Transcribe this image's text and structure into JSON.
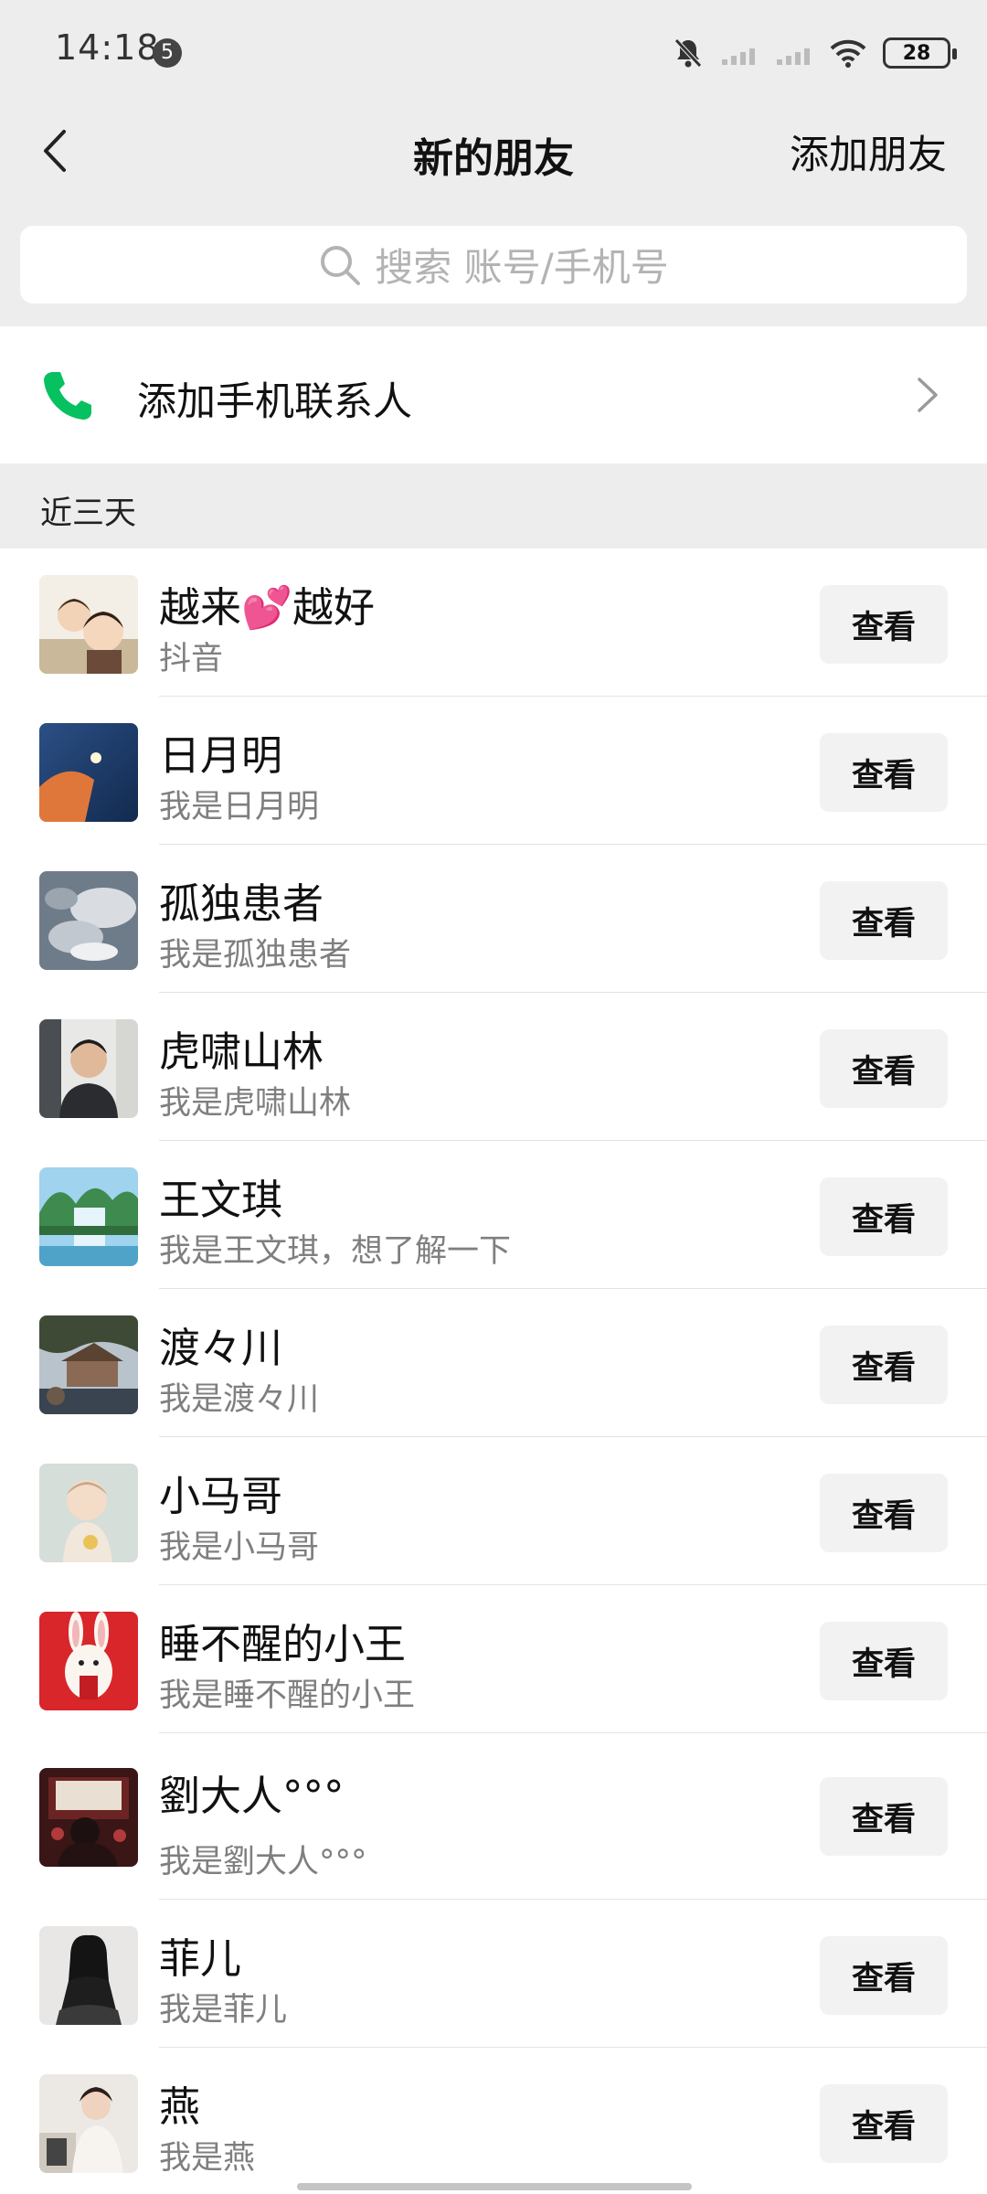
{
  "status_bar": {
    "time": "14:18",
    "notification_badge": "5",
    "battery_level": "28",
    "icons": [
      "mute-bell-icon",
      "signal-icon",
      "signal-icon",
      "wifi-icon",
      "battery-icon"
    ]
  },
  "nav": {
    "title": "新的朋友",
    "action_label": "添加朋友",
    "back_icon": "chevron-left-icon"
  },
  "search": {
    "placeholder": "搜索 账号/手机号",
    "icon": "search-icon"
  },
  "phone_contacts": {
    "label": "添加手机联系人",
    "icon": "phone-icon",
    "accent_color": "#07c160"
  },
  "section": {
    "title": "近三天"
  },
  "requests": [
    {
      "name": "越来💕越好",
      "subtitle": "抖音",
      "button": "查看"
    },
    {
      "name": "日月明",
      "subtitle": "我是日月明",
      "button": "查看"
    },
    {
      "name": "孤独患者",
      "subtitle": "我是孤独患者",
      "button": "查看"
    },
    {
      "name": "虎啸山林",
      "subtitle": "我是虎啸山林",
      "button": "查看"
    },
    {
      "name": "王文琪",
      "subtitle": "我是王文琪，想了解一下",
      "button": "查看"
    },
    {
      "name": "渡々川",
      "subtitle": "我是渡々川",
      "button": "查看"
    },
    {
      "name": "小马哥",
      "subtitle": "我是小马哥",
      "button": "查看"
    },
    {
      "name": "睡不醒的小王",
      "subtitle": "我是睡不醒的小王",
      "button": "查看"
    },
    {
      "name": "劉大人°°°",
      "subtitle": "我是劉大人°°°",
      "button": "查看"
    },
    {
      "name": "菲儿",
      "subtitle": "我是菲儿",
      "button": "查看"
    },
    {
      "name": "燕",
      "subtitle": "我是燕",
      "button": "查看"
    }
  ]
}
